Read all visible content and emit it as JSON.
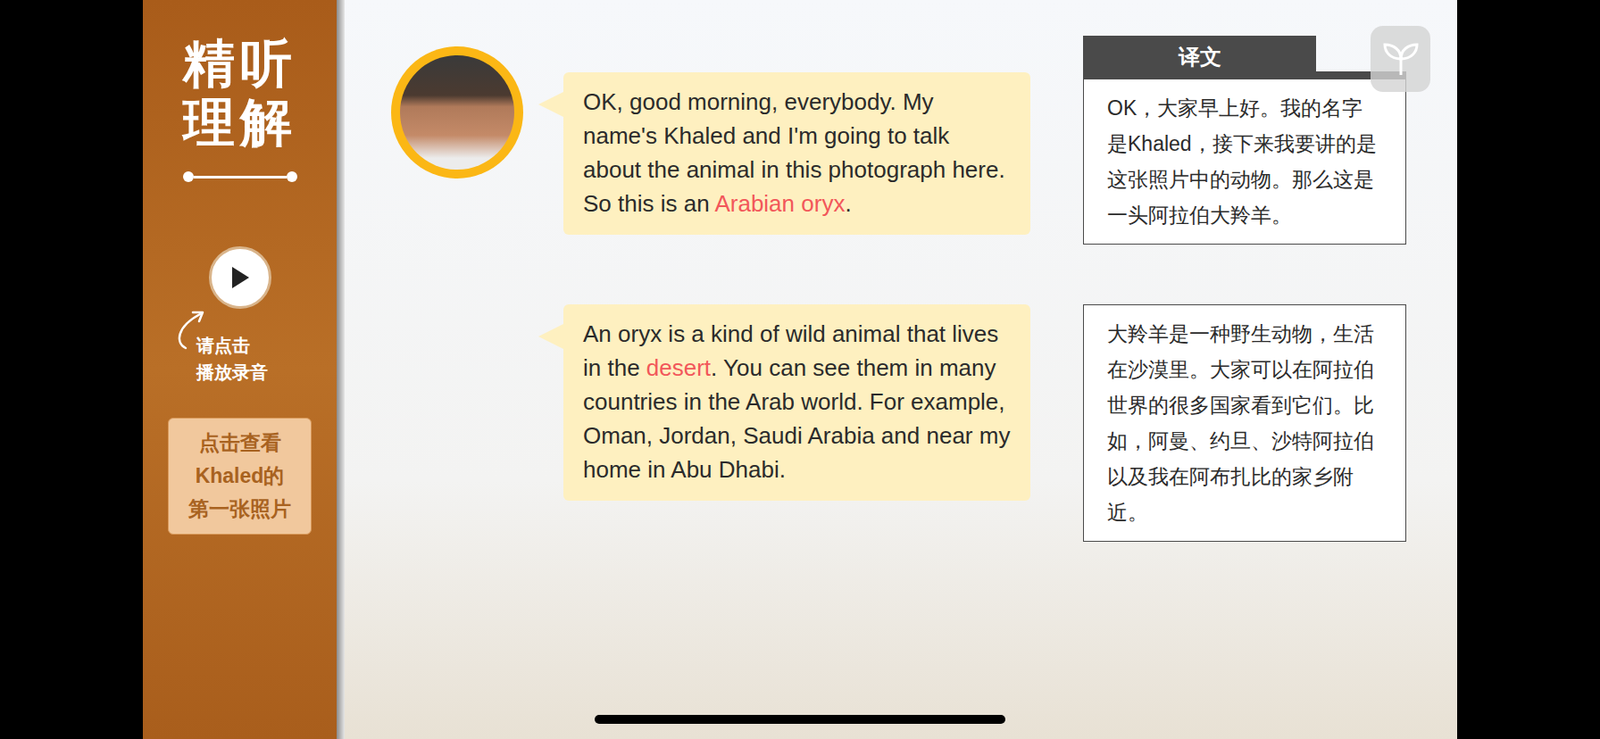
{
  "sidebar": {
    "title_lines": [
      "精听",
      "理解"
    ],
    "hint_lines": [
      "请点击",
      "播放录音"
    ],
    "photo_button_lines": [
      "点击查看",
      "Khaled的",
      "第一张照片"
    ]
  },
  "translation_label": "译文",
  "dialogue": [
    {
      "segments": [
        {
          "text": "OK, good morning, everybody. My name's Khaled and I'm going to talk about the animal in this photograph here. So this is an ",
          "highlight": false
        },
        {
          "text": "Arabian oryx",
          "highlight": true
        },
        {
          "text": ".",
          "highlight": false
        }
      ],
      "translation": "OK，大家早上好。我的名字是Khaled，接下来我要讲的是这张照片中的动物。那么这是一头阿拉伯大羚羊。"
    },
    {
      "segments": [
        {
          "text": "An oryx is a kind of wild animal that lives in the ",
          "highlight": false
        },
        {
          "text": "desert",
          "highlight": true
        },
        {
          "text": ". You can see them in many countries in the Arab world. For example, Oman, Jordan, Saudi Arabia and near my home in Abu Dhabi.",
          "highlight": false
        }
      ],
      "translation": "大羚羊是一种野生动物，生活在沙漠里。大家可以在阿拉伯世界的很多国家看到它们。比如，阿曼、约旦、沙特阿拉伯以及我在阿布扎比的家乡附近。"
    }
  ]
}
